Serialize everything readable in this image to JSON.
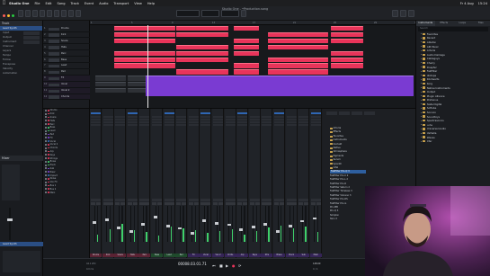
{
  "menubar": {
    "app": "Studio One",
    "items": [
      "File",
      "Edit",
      "Song",
      "Track",
      "Event",
      "Audio",
      "Transport",
      "View",
      "Help"
    ],
    "clock": "Fr 4 Aug",
    "time": "15:24"
  },
  "toolbar": {
    "window_title": "Studio One - •Production.song"
  },
  "inspector": {
    "tabs": [
      "Track",
      "Mixer"
    ],
    "rows": [
      "Lead Synth",
      "Input",
      "Output",
      "Instrument",
      "Channel",
      "Layers",
      "Tempo",
      "Follow",
      "Transpose",
      "Velocity",
      "Automation"
    ],
    "bottom_label": "Lead Synth"
  },
  "tracks": [
    {
      "num": "1",
      "name": "Drums",
      "kind": "red"
    },
    {
      "num": "2",
      "name": "Kick",
      "kind": "red"
    },
    {
      "num": "3",
      "name": "Snare",
      "kind": "red"
    },
    {
      "num": "4",
      "name": "Hats",
      "kind": "red"
    },
    {
      "num": "5",
      "name": "Perc",
      "kind": "red"
    },
    {
      "num": "6",
      "name": "Bass",
      "kind": "red"
    },
    {
      "num": "7",
      "name": "Lead",
      "kind": "red"
    },
    {
      "num": "8",
      "name": "Pad",
      "kind": "red"
    },
    {
      "num": "9",
      "name": "FX",
      "kind": "purple"
    },
    {
      "num": "10",
      "name": "Vocal",
      "kind": "purple"
    },
    {
      "num": "11",
      "name": "Vocal 2",
      "kind": "purple"
    },
    {
      "num": "12",
      "name": "Chords",
      "kind": "purple"
    }
  ],
  "ruler_marks": [
    "1",
    "5",
    "9",
    "13",
    "17",
    "21",
    "25",
    "29",
    "33"
  ],
  "browser": {
    "tabs": [
      "Instruments",
      "Effects",
      "Loops",
      "Files"
    ],
    "search_placeholder": "Search",
    "items": [
      "Favorites",
      "Recent",
      "Ableton",
      "AIR Music",
      "Arturia",
      "Audio Damage",
      "Cableguys",
      "Cherry",
      "Doepfer",
      "FabFilter",
      "iZotope",
      "Kilohearts",
      "Korg",
      "Native Instruments",
      "Output",
      "Plugin Alliance",
      "PreSonus",
      "Slate Digital",
      "Softube",
      "Sonnox",
      "Soundtoys",
      "Spectrasonics",
      "u-he",
      "Universal Audio",
      "Valhalla",
      "Waves",
      "Xfer"
    ]
  },
  "mixer": {
    "list": [
      "Drums",
      "Kick",
      "Snare",
      "Hats",
      "Perc",
      "Bass",
      "Lead",
      "Pad",
      "FX",
      "Vocal",
      "Vocal 2",
      "Chords",
      "Arp",
      "Keys",
      "Strings",
      "Brass",
      "Pluck",
      "Sub",
      "Riser",
      "Impact",
      "Noise",
      "Vox FX",
      "Bus 1",
      "Bus 2",
      "Main"
    ],
    "strips": [
      "Drums",
      "Kick",
      "Snare",
      "Hats",
      "Perc",
      "Bass",
      "Lead",
      "Pad",
      "FX",
      "Vocal",
      "Vox 2",
      "Chrds",
      "Arp",
      "Keys",
      "Strs",
      "Brass",
      "Pluck",
      "Sub",
      "Main"
    ]
  },
  "plugins": {
    "items": [
      "Arturia",
      "Effects",
      "Favorites",
      "Instruments",
      "Kontakt",
      "Native",
      "Omnisphere",
      "Pigments",
      "Serum",
      "Sylenth",
      "Vital",
      "FabFilter Pro-Q 3",
      "FabFilter Pro-C 2",
      "FabFilter Pro-L 2",
      "FabFilter Pro-R",
      "FabFilter Saturn 2",
      "FabFilter Timeless 3",
      "FabFilter Volcano 3",
      "FabFilter Pro-DS",
      "FabFilter Pro-G",
      "Pro-MB",
      "Pro-Q 3",
      "Simplon",
      "Twin 3"
    ],
    "selected_index": 11
  },
  "transport": {
    "time": "00008.03.01.71",
    "sub1": "44.1 kHz",
    "sub2": "0.0 ms",
    "tempo": "128.00",
    "sig": "4 / 4"
  },
  "colors": {
    "red_clip": "#e8345a",
    "purple_clip": "#7a3bd2",
    "accent_blue": "#2f66b3"
  }
}
